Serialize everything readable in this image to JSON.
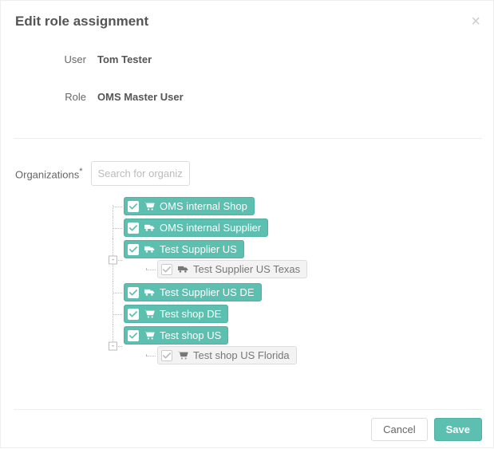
{
  "dialog": {
    "title": "Edit role assignment",
    "close_label": "×"
  },
  "fields": {
    "user_label": "User",
    "user_value": "Tom Tester",
    "role_label": "Role",
    "role_value": "OMS Master User",
    "organizations_label": "Organizations",
    "required_mark": "*"
  },
  "search": {
    "placeholder": "Search for organiz"
  },
  "tree": [
    {
      "id": 0,
      "label": "OMS internal Shop",
      "icon": "cart",
      "selected": true,
      "children": []
    },
    {
      "id": 1,
      "label": "OMS internal Supplier",
      "icon": "truck",
      "selected": true,
      "children": []
    },
    {
      "id": 2,
      "label": "Test Supplier US",
      "icon": "truck",
      "selected": true,
      "expanded": true,
      "children": [
        {
          "id": 3,
          "label": "Test Supplier US Texas",
          "icon": "truck",
          "selected": false,
          "children": []
        }
      ]
    },
    {
      "id": 4,
      "label": "Test Supplier US DE",
      "icon": "truck",
      "selected": true,
      "children": []
    },
    {
      "id": 5,
      "label": "Test shop DE",
      "icon": "cart",
      "selected": true,
      "children": []
    },
    {
      "id": 6,
      "label": "Test shop US",
      "icon": "cart",
      "selected": true,
      "expanded": true,
      "children": [
        {
          "id": 7,
          "label": "Test shop US Florida",
          "icon": "cart",
          "selected": false,
          "children": []
        }
      ]
    }
  ],
  "footer": {
    "cancel": "Cancel",
    "save": "Save"
  },
  "colors": {
    "accent": "#5cbfb0"
  }
}
